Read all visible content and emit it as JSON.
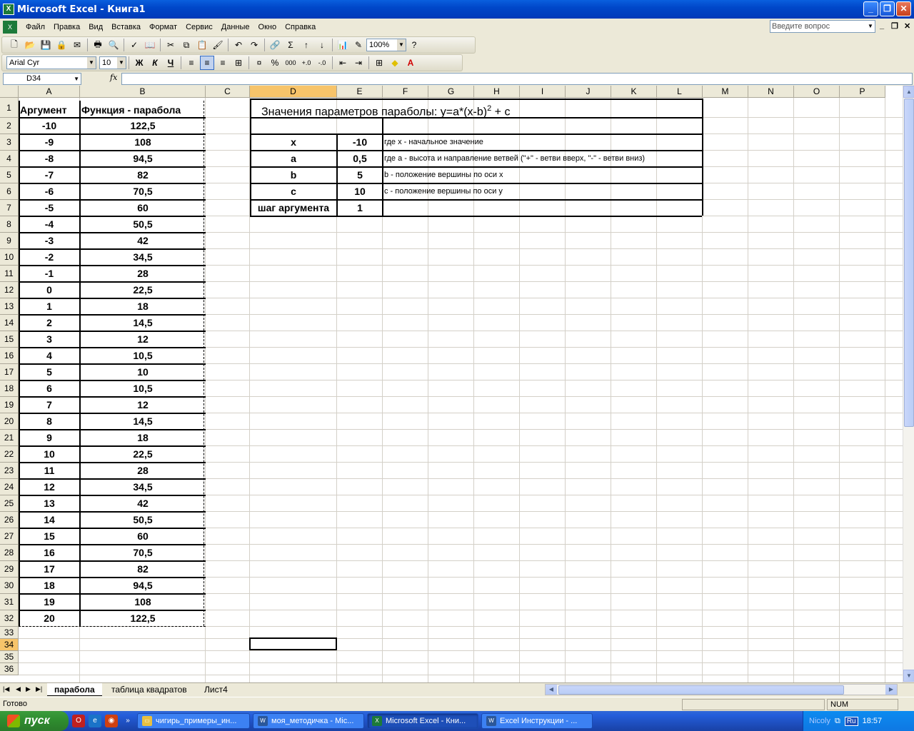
{
  "window": {
    "title": "Microsoft Excel - Книга1"
  },
  "menu": [
    "Файл",
    "Правка",
    "Вид",
    "Вставка",
    "Формат",
    "Сервис",
    "Данные",
    "Окно",
    "Справка"
  ],
  "help": {
    "placeholder": "Введите вопрос"
  },
  "toolbar": {
    "zoom": "100%",
    "font": "Arial Cyr",
    "font_size": "10",
    "bold": "Ж",
    "italic": "К",
    "underline": "Ч",
    "percent": "%",
    "thousands": "000",
    "sum": "Σ"
  },
  "formula_bar": {
    "name_box": "D34",
    "fx": "fx",
    "formula": ""
  },
  "columns": [
    "A",
    "B",
    "C",
    "D",
    "E",
    "F",
    "G",
    "H",
    "I",
    "J",
    "K",
    "L",
    "M",
    "N",
    "O",
    "P"
  ],
  "rows": [
    "1",
    "2",
    "3",
    "4",
    "5",
    "6",
    "7",
    "8",
    "9",
    "10",
    "11",
    "12",
    "13",
    "14",
    "15",
    "16",
    "17",
    "18",
    "19",
    "20",
    "21",
    "22",
    "23",
    "24",
    "25",
    "26",
    "27",
    "28",
    "29",
    "30",
    "31",
    "32",
    "33",
    "34",
    "35",
    "36"
  ],
  "table": {
    "header_a": "Аргумент",
    "header_b": "Функция -  парабола",
    "args": [
      "-10",
      "-9",
      "-8",
      "-7",
      "-6",
      "-5",
      "-4",
      "-3",
      "-2",
      "-1",
      "0",
      "1",
      "2",
      "3",
      "4",
      "5",
      "6",
      "7",
      "8",
      "9",
      "10",
      "11",
      "12",
      "13",
      "14",
      "15",
      "16",
      "17",
      "18",
      "19",
      "20"
    ],
    "values": [
      "122,5",
      "108",
      "94,5",
      "82",
      "70,5",
      "60",
      "50,5",
      "42",
      "34,5",
      "28",
      "22,5",
      "18",
      "14,5",
      "12",
      "10,5",
      "10",
      "10,5",
      "12",
      "14,5",
      "18",
      "22,5",
      "28",
      "34,5",
      "42",
      "50,5",
      "60",
      "70,5",
      "82",
      "94,5",
      "108",
      "122,5"
    ]
  },
  "params": {
    "title_prefix": "Значения параметров параболы:  y=a*(x-b)",
    "title_exp": "2",
    "title_suffix": " + c",
    "rows": [
      {
        "name": "x",
        "value": "-10",
        "desc": "где x - начальное значение"
      },
      {
        "name": "a",
        "value": "0,5",
        "desc": "где a - высота и направление ветвей (\"+\" - ветви вверх, \"-\" - ветви вниз)"
      },
      {
        "name": "b",
        "value": "5",
        "desc": " b - положение вершины по оси  x"
      },
      {
        "name": "c",
        "value": "10",
        "desc": "c - положение вершины по оси  y"
      },
      {
        "name": "шаг аргумента",
        "value": "1",
        "desc": ""
      }
    ]
  },
  "sheet_tabs": [
    "парабола",
    "таблица квадратов",
    "Лист4"
  ],
  "status": {
    "text": "Готово",
    "num": "NUM"
  },
  "taskbar": {
    "start": "пуск",
    "tasks": [
      "чигирь_примеры_ин...",
      "моя_методичка - Mic...",
      "Microsoft Excel - Кни...",
      "Excel Инструкции - ..."
    ],
    "user": "Nicoly",
    "lang": "Ru",
    "clock": "18:57"
  },
  "colors": {
    "title_blue": "#0047c9",
    "active_header": "#f7c46a",
    "taskbar_blue": "#245edb",
    "start_green": "#2e8b2e"
  }
}
